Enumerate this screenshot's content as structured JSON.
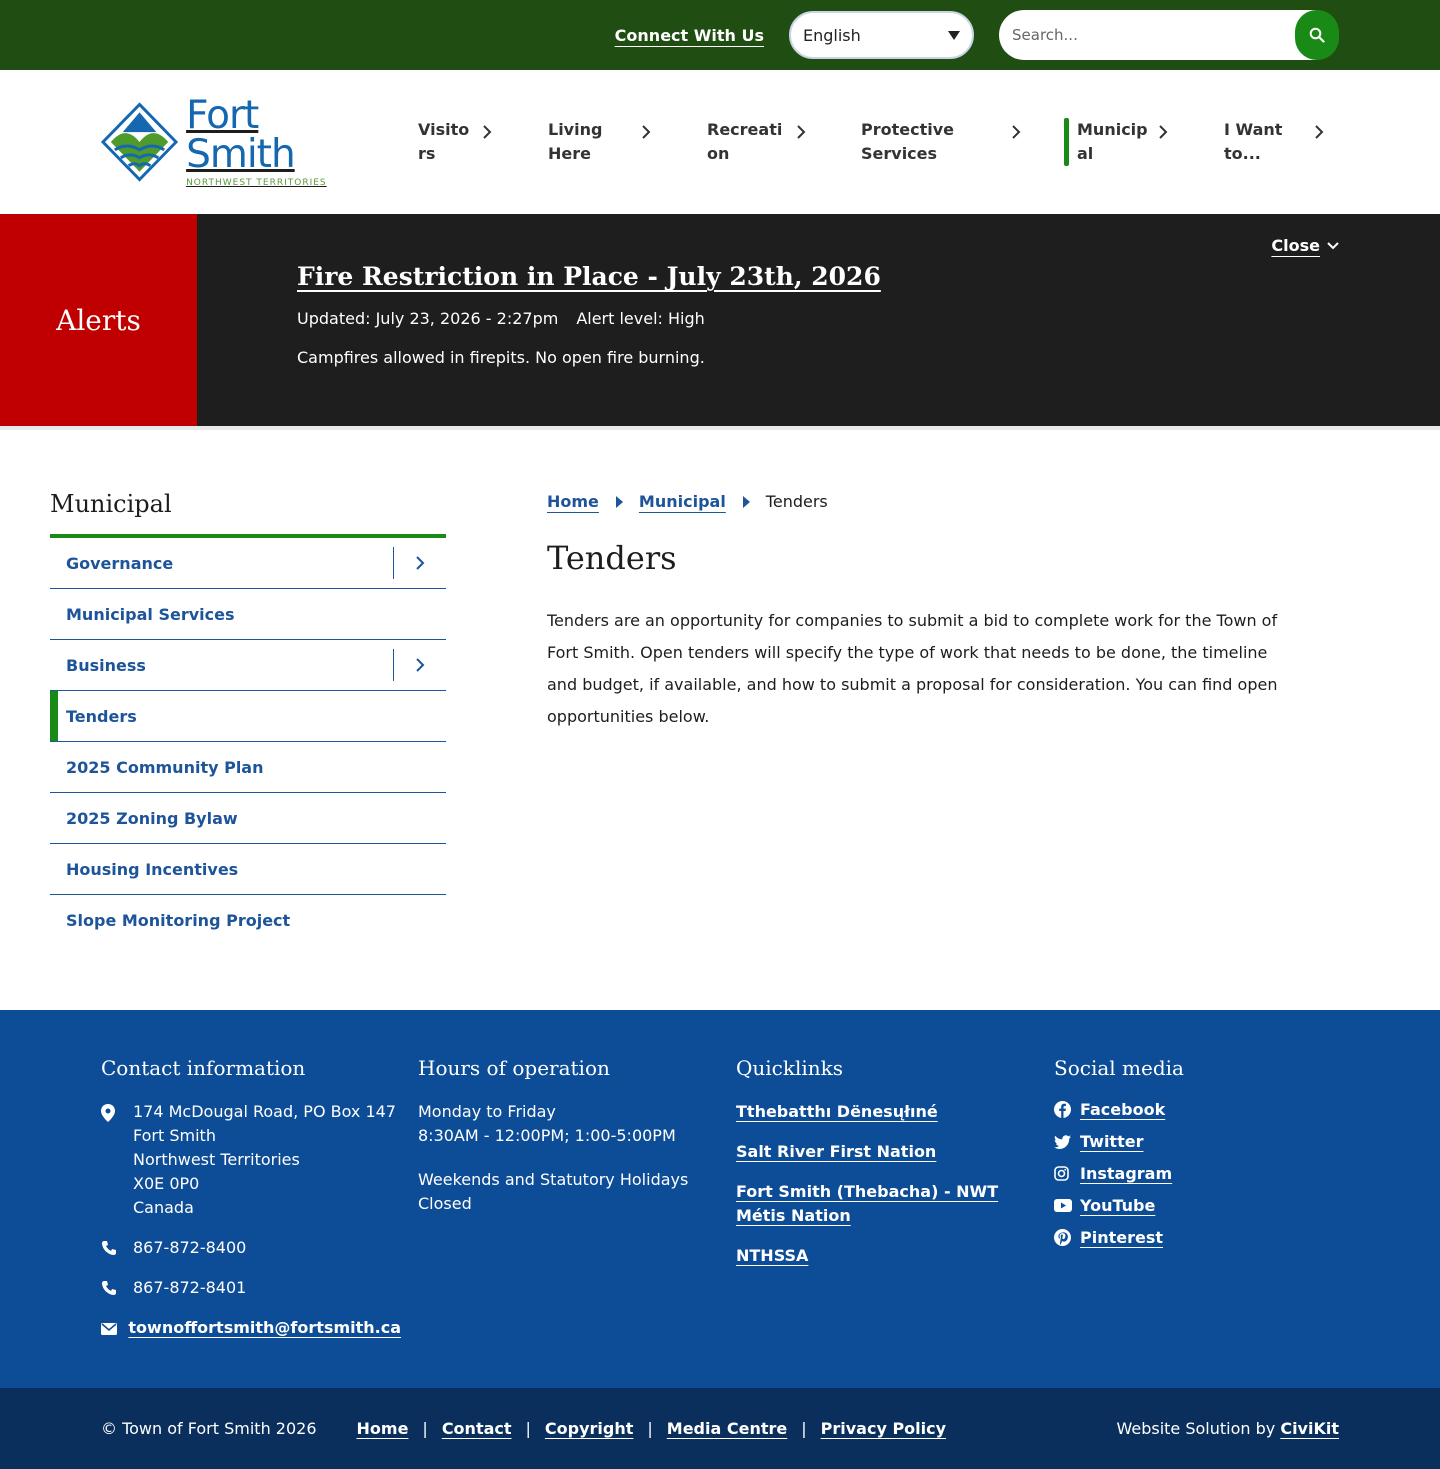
{
  "topbar": {
    "connect_label": "Connect With Us",
    "language": "English",
    "search_placeholder": "Search..."
  },
  "header": {
    "logo_name": "Fort Smith",
    "logo_sub": "NORTHWEST TERRITORIES",
    "nav": [
      {
        "label": "Visitors"
      },
      {
        "label": "Living Here"
      },
      {
        "label": "Recreation"
      },
      {
        "label": "Protective Services"
      },
      {
        "label": "Municipal"
      },
      {
        "label": "I Want to..."
      }
    ]
  },
  "alert": {
    "box_label": "Alerts",
    "title": "Fire Restriction in Place - July 23th, 2026",
    "updated": "Updated: July 23, 2026 - 2:27pm",
    "level": "Alert level: High",
    "description": "Campfires allowed in firepits. No open fire burning.",
    "close_label": "Close"
  },
  "sidebar": {
    "title": "Municipal",
    "items": [
      {
        "label": "Governance"
      },
      {
        "label": "Municipal Services"
      },
      {
        "label": "Business"
      },
      {
        "label": "Tenders"
      },
      {
        "label": "2025 Community Plan"
      },
      {
        "label": "2025 Zoning Bylaw"
      },
      {
        "label": "Housing Incentives"
      },
      {
        "label": "Slope Monitoring Project"
      }
    ]
  },
  "breadcrumb": {
    "home": "Home",
    "section": "Municipal",
    "current": "Tenders"
  },
  "main": {
    "title": "Tenders",
    "body": "Tenders are an opportunity for companies to submit a bid to complete work for the Town of Fort Smith. Open tenders will specify the type of work that needs to be done, the timeline and budget, if available, and how to submit a proposal for consideration. You can find open opportunities below."
  },
  "footer": {
    "contact": {
      "title": "Contact information",
      "address": [
        "174 McDougal Road, PO Box 147",
        "Fort Smith",
        "Northwest Territories",
        "X0E 0P0",
        "Canada"
      ],
      "phone1": "867-872-8400",
      "phone2": "867-872-8401",
      "email": "townoffortsmith@fortsmith.ca"
    },
    "hours": {
      "title": "Hours of operation",
      "days": "Monday to Friday",
      "times": "8:30AM - 12:00PM; 1:00-5:00PM",
      "weekend": "Weekends and Statutory Holidays",
      "weekend_status": "Closed"
    },
    "quicklinks": {
      "title": "Quicklinks",
      "links": [
        "Tthebatthı Dënesųłıné",
        "Salt River First Nation",
        "Fort Smith (Thebacha) - NWT Métis Nation",
        "NTHSSA"
      ]
    },
    "social": {
      "title": "Social media",
      "links": [
        "Facebook",
        "Twitter",
        "Instagram",
        "YouTube",
        "Pinterest"
      ]
    }
  },
  "bottombar": {
    "copyright": "© Town of Fort Smith 2026",
    "links": [
      "Home",
      "Contact",
      "Copyright",
      "Media Centre",
      "Privacy Policy"
    ],
    "credit_prefix": "Website Solution by",
    "credit_link": "CiviKit"
  },
  "colors": {
    "topbar": "#1f4d12",
    "accent_green": "#1a8a17",
    "alert_red": "#c00000",
    "alert_dark": "#1e1e1e",
    "link_blue": "#1e5499",
    "footer_blue": "#0d4c96",
    "bottombar_navy": "#0a2f5c"
  }
}
